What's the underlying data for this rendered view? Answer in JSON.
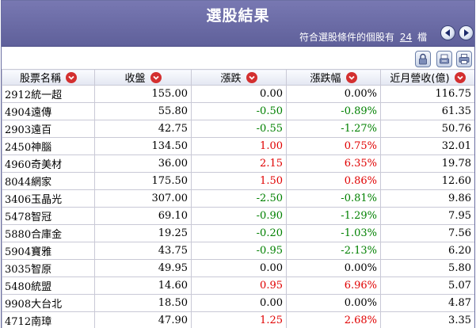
{
  "header": {
    "title": "選股結果",
    "count_prefix": "符合選股條件的個股有",
    "count": "24",
    "count_suffix": "檔"
  },
  "columns": [
    "股票名稱",
    "收盤",
    "漲跌",
    "漲跌幅",
    "近月營收(億)"
  ],
  "rows": [
    {
      "name": "2912統一超",
      "close": "155.00",
      "change": "0.00",
      "pct": "0.00%",
      "revenue": "116.75",
      "dir": "flat"
    },
    {
      "name": "4904遠傳",
      "close": "55.80",
      "change": "-0.50",
      "pct": "-0.89%",
      "revenue": "61.35",
      "dir": "down"
    },
    {
      "name": "2903遠百",
      "close": "42.75",
      "change": "-0.55",
      "pct": "-1.27%",
      "revenue": "50.76",
      "dir": "down"
    },
    {
      "name": "2450神腦",
      "close": "134.50",
      "change": "1.00",
      "pct": "0.75%",
      "revenue": "32.01",
      "dir": "up"
    },
    {
      "name": "4960奇美材",
      "close": "36.00",
      "change": "2.15",
      "pct": "6.35%",
      "revenue": "19.78",
      "dir": "up"
    },
    {
      "name": "8044網家",
      "close": "175.50",
      "change": "1.50",
      "pct": "0.86%",
      "revenue": "12.60",
      "dir": "up"
    },
    {
      "name": "3406玉晶光",
      "close": "307.00",
      "change": "-2.50",
      "pct": "-0.81%",
      "revenue": "9.86",
      "dir": "down"
    },
    {
      "name": "5478智冠",
      "close": "69.10",
      "change": "-0.90",
      "pct": "-1.29%",
      "revenue": "7.95",
      "dir": "down"
    },
    {
      "name": "5880合庫金",
      "close": "19.25",
      "change": "-0.20",
      "pct": "-1.03%",
      "revenue": "7.56",
      "dir": "down"
    },
    {
      "name": "5904寶雅",
      "close": "43.75",
      "change": "-0.95",
      "pct": "-2.13%",
      "revenue": "6.20",
      "dir": "down"
    },
    {
      "name": "3035智原",
      "close": "49.95",
      "change": "0.00",
      "pct": "0.00%",
      "revenue": "5.80",
      "dir": "flat"
    },
    {
      "name": "5480統盟",
      "close": "14.60",
      "change": "0.95",
      "pct": "6.96%",
      "revenue": "5.07",
      "dir": "up"
    },
    {
      "name": "9908大台北",
      "close": "18.50",
      "change": "0.00",
      "pct": "0.00%",
      "revenue": "4.87",
      "dir": "flat"
    },
    {
      "name": "4712南璋",
      "close": "47.90",
      "change": "1.25",
      "pct": "2.68%",
      "revenue": "3.35",
      "dir": "up"
    }
  ],
  "colors": {
    "up": "#e00000",
    "down": "#008000",
    "flat": "#000000",
    "header_bg": "#6a6ba6"
  },
  "icons": {
    "nav_prev": "arrow-left-icon",
    "nav_next": "arrow-right-icon",
    "tools": [
      "lock-icon",
      "export-icon",
      "print-icon"
    ],
    "sort": "sort-down-icon"
  }
}
